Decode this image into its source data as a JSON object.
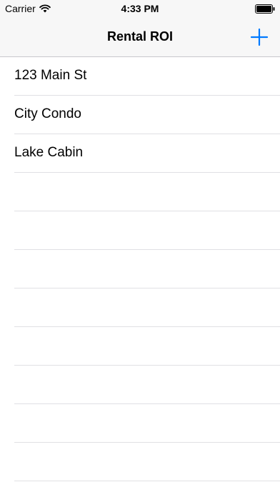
{
  "status_bar": {
    "carrier": "Carrier",
    "time": "4:33 PM"
  },
  "nav": {
    "title": "Rental ROI",
    "add_icon": "plus-icon"
  },
  "accent_color": "#007aff",
  "properties": [
    {
      "label": "123 Main St"
    },
    {
      "label": "City Condo"
    },
    {
      "label": "Lake Cabin"
    }
  ]
}
